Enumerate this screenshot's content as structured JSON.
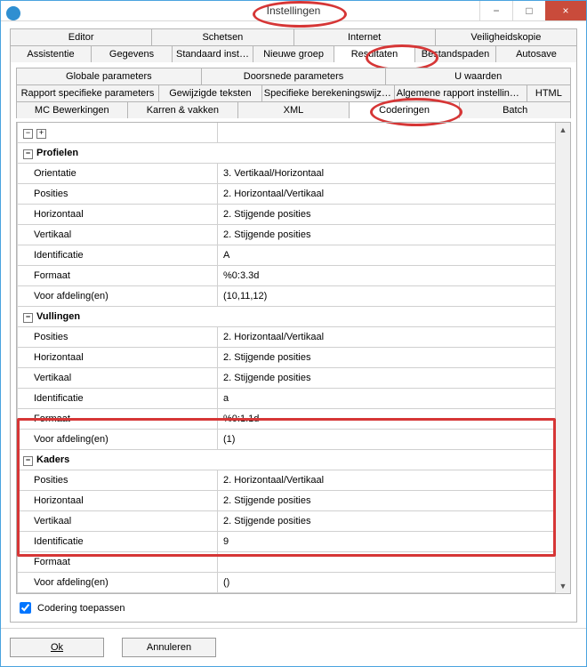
{
  "window": {
    "title": "Instellingen"
  },
  "winbtns": {
    "min": "−",
    "max": "□",
    "close": "×"
  },
  "tabs_row1": [
    "Editor",
    "Schetsen",
    "Internet",
    "Veiligheidskopie"
  ],
  "tabs_row2": [
    "Assistentie",
    "Gegevens",
    "Standaard instellingen",
    "Nieuwe groep",
    "Resultaten",
    "Bestandspaden",
    "Autosave"
  ],
  "tabs_row3": [
    "Globale parameters",
    "Doorsnede parameters",
    "U waarden"
  ],
  "tabs_row4": [
    "Rapport specifieke parameters",
    "Gewijzigde teksten",
    "Specifieke berekeningswijzen",
    "Algemene rapport instellingen",
    "HTML"
  ],
  "tabs_row5": [
    "MC Bewerkingen",
    "Karren & vakken",
    "XML",
    "Coderingen",
    "Batch"
  ],
  "groups": [
    {
      "name": "Profielen",
      "rows": [
        {
          "k": "Orientatie",
          "v": "3. Vertikaal/Horizontaal"
        },
        {
          "k": "Posities",
          "v": "2. Horizontaal/Vertikaal"
        },
        {
          "k": "Horizontaal",
          "v": "2. Stijgende posities"
        },
        {
          "k": "Vertikaal",
          "v": "2. Stijgende posities"
        },
        {
          "k": "Identificatie",
          "v": "A"
        },
        {
          "k": "Formaat",
          "v": "%0:3.3d"
        },
        {
          "k": "Voor afdeling(en)",
          "v": "(10,11,12)"
        }
      ]
    },
    {
      "name": "Vullingen",
      "rows": [
        {
          "k": "Posities",
          "v": "2. Horizontaal/Vertikaal"
        },
        {
          "k": "Horizontaal",
          "v": "2. Stijgende posities"
        },
        {
          "k": "Vertikaal",
          "v": "2. Stijgende posities"
        },
        {
          "k": "Identificatie",
          "v": "a"
        },
        {
          "k": "Formaat",
          "v": "%0:1.1d"
        },
        {
          "k": "Voor afdeling(en)",
          "v": "(1)"
        }
      ]
    },
    {
      "name": "Kaders",
      "rows": [
        {
          "k": "Posities",
          "v": "2. Horizontaal/Vertikaal"
        },
        {
          "k": "Horizontaal",
          "v": "2. Stijgende posities"
        },
        {
          "k": "Vertikaal",
          "v": "2. Stijgende posities"
        },
        {
          "k": "Identificatie",
          "v": "9"
        },
        {
          "k": "Formaat",
          "v": ""
        },
        {
          "k": "Voor afdeling(en)",
          "v": "()"
        }
      ]
    }
  ],
  "checkbox": {
    "label": "Codering toepassen",
    "checked": true
  },
  "footer": {
    "ok": "Ok",
    "cancel": "Annuleren"
  },
  "toggle": {
    "collapse": "−",
    "expand": "+"
  }
}
